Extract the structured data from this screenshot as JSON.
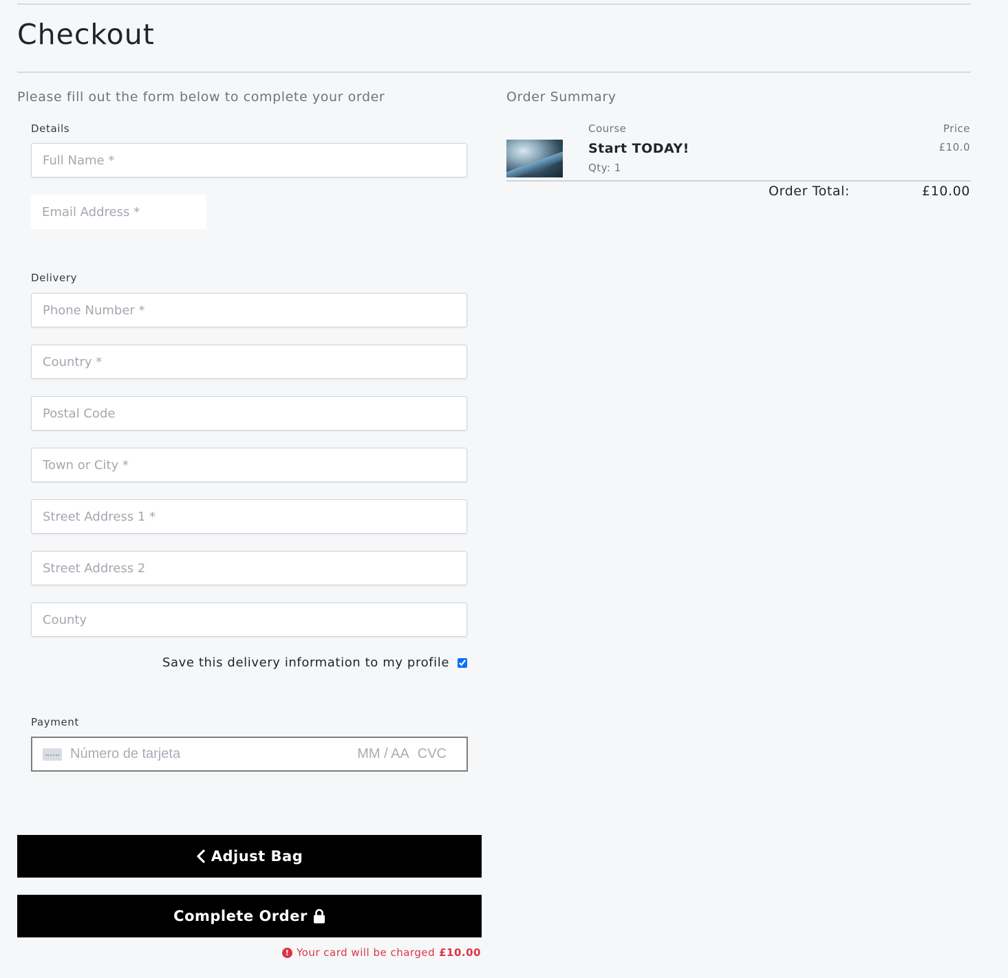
{
  "page": {
    "title": "Checkout",
    "intro": "Please fill out the form below to complete your order"
  },
  "details": {
    "label": "Details",
    "full_name_placeholder": "Full Name *",
    "email_placeholder": "Email Address *"
  },
  "delivery": {
    "label": "Delivery",
    "phone_placeholder": "Phone Number *",
    "country_placeholder": "Country *",
    "postcode_placeholder": "Postal Code",
    "town_placeholder": "Town or City *",
    "street1_placeholder": "Street Address 1 *",
    "street2_placeholder": "Street Address 2",
    "county_placeholder": "County",
    "save_info_label": "Save this delivery information to my profile",
    "save_info_checked": true
  },
  "payment": {
    "label": "Payment",
    "card_number_placeholder": "Número de tarjeta",
    "expiry_placeholder": "MM / AA",
    "cvc_placeholder": "CVC"
  },
  "buttons": {
    "adjust_bag": "Adjust Bag",
    "complete_order": "Complete Order"
  },
  "charge_notice": {
    "text": "Your card will be charged",
    "amount": "£10.00",
    "color": "#dc3545"
  },
  "summary": {
    "title": "Order Summary",
    "course_header": "Course",
    "price_header": "Price",
    "items": [
      {
        "name": "Start TODAY!",
        "qty": "Qty: 1",
        "price": "£10.0"
      }
    ],
    "total_label": "Order Total:",
    "total_value": "£10.00"
  },
  "icons": {
    "back": "chevron-left-icon",
    "lock": "lock-icon",
    "alert": "exclamation-circle-icon",
    "card": "credit-card-icon"
  }
}
